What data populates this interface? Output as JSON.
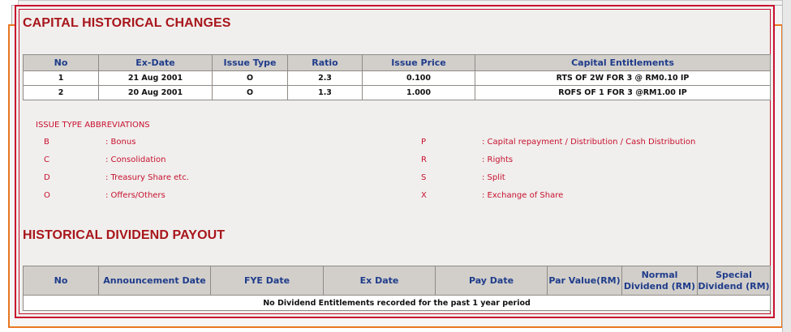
{
  "capital": {
    "title": "CAPITAL HISTORICAL CHANGES",
    "headers": [
      "No",
      "Ex-Date",
      "Issue Type",
      "Ratio",
      "Issue Price",
      "Capital Entitlements"
    ],
    "rows": [
      [
        "1",
        "21 Aug 2001",
        "O",
        "2.3",
        "0.100",
        "RTS OF 2W FOR 3 @ RM0.10 IP"
      ],
      [
        "2",
        "20 Aug 2001",
        "O",
        "1.3",
        "1.000",
        "ROFS OF 1 FOR 3 @RM1.00 IP"
      ]
    ]
  },
  "abbreviations": {
    "title": "ISSUE TYPE ABBREVIATIONS",
    "left": [
      {
        "code": "B",
        "desc": ": Bonus"
      },
      {
        "code": "C",
        "desc": ": Consolidation"
      },
      {
        "code": "D",
        "desc": ": Treasury Share etc."
      },
      {
        "code": "O",
        "desc": ": Offers/Others"
      }
    ],
    "right": [
      {
        "code": "P",
        "desc": ": Capital repayment / Distribution / Cash Distribution"
      },
      {
        "code": "R",
        "desc": ": Rights"
      },
      {
        "code": "S",
        "desc": ": Split"
      },
      {
        "code": "X",
        "desc": ": Exchange of Share"
      }
    ]
  },
  "dividend": {
    "title": "HISTORICAL DIVIDEND PAYOUT",
    "headers": [
      "No",
      "Announcement Date",
      "FYE Date",
      "Ex Date",
      "Pay Date",
      "Par Value(RM)",
      "Normal\nDividend (RM)",
      "Special\nDividend (RM)"
    ],
    "headers_line1": [
      "No",
      "Announcement Date",
      "FYE Date",
      "Ex Date",
      "Pay Date",
      "Par Value(RM)",
      "Normal",
      "Special"
    ],
    "headers_line2": [
      "",
      "",
      "",
      "",
      "",
      "",
      "Dividend (RM)",
      "Dividend (RM)"
    ],
    "empty_message": "No Dividend Entitlements recorded for the past 1 year period"
  },
  "colors": {
    "accent_red": "#c8102e",
    "title_red": "#a8151b",
    "header_blue": "#1f3c8a",
    "header_bg": "#d2cfcb",
    "orange_frame": "#e87722"
  }
}
